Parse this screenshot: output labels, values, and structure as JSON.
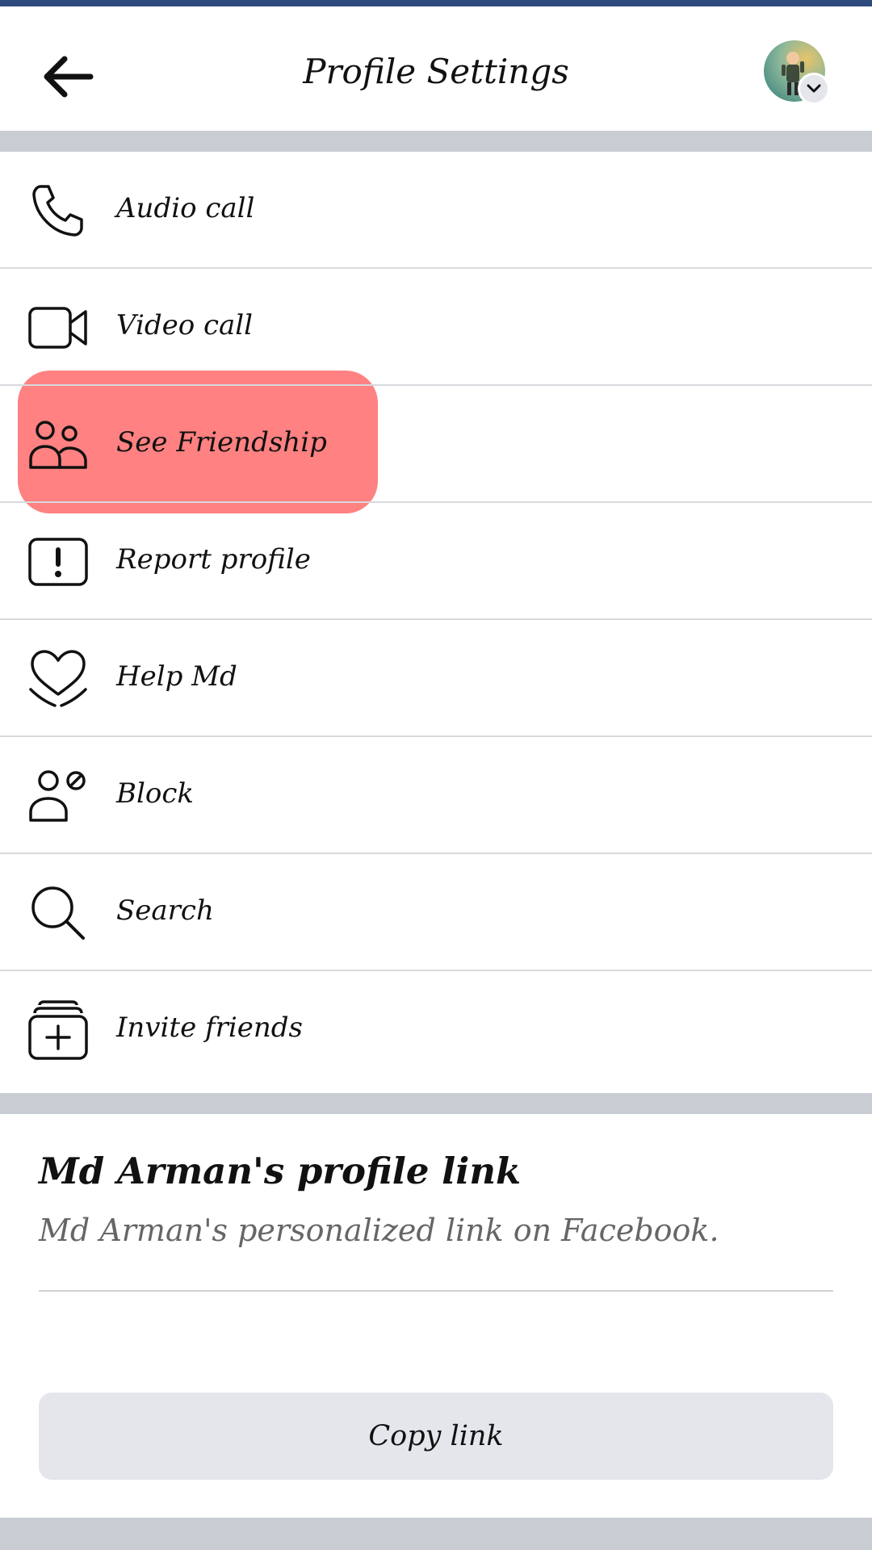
{
  "header": {
    "title": "Profile Settings"
  },
  "menu": {
    "items": [
      {
        "label": "Audio call",
        "icon": "phone-icon"
      },
      {
        "label": "Video call",
        "icon": "video-camera-icon"
      },
      {
        "label": "See Friendship",
        "icon": "people-icon"
      },
      {
        "label": "Report profile",
        "icon": "exclamation-icon"
      },
      {
        "label": "Help Md",
        "icon": "heart-hands-icon"
      },
      {
        "label": "Block",
        "icon": "block-user-icon"
      },
      {
        "label": "Search",
        "icon": "search-icon"
      },
      {
        "label": "Invite friends",
        "icon": "invite-stack-icon"
      }
    ]
  },
  "profile_link": {
    "title": "Md Arman's profile link",
    "subtitle": "Md Arman's personalized link on Facebook.",
    "button_label": "Copy link"
  },
  "colors": {
    "top_accent": "#2d4a7f",
    "separator": "#c9ccd3",
    "highlight": "#ff4646",
    "button_bg": "#e4e6eb"
  }
}
